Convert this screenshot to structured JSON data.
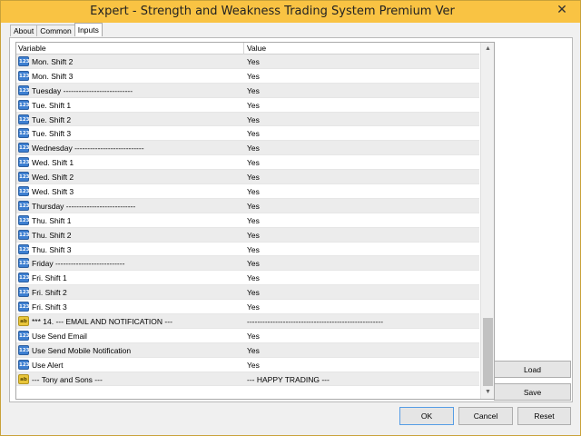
{
  "window": {
    "title": "Expert - Strength and Weakness Trading System Premium Ver",
    "close_glyph": "✕"
  },
  "tabs": [
    {
      "label": "About"
    },
    {
      "label": "Common"
    },
    {
      "label": "Inputs"
    }
  ],
  "grid": {
    "col_variable": "Variable",
    "col_value": "Value",
    "rows": [
      {
        "icon": "123",
        "name": "Mon. Shift 2",
        "value": "Yes"
      },
      {
        "icon": "123",
        "name": "Mon. Shift 3",
        "value": "Yes"
      },
      {
        "icon": "123",
        "name": "Tuesday ---------------------------",
        "value": "Yes"
      },
      {
        "icon": "123",
        "name": "Tue. Shift 1",
        "value": "Yes"
      },
      {
        "icon": "123",
        "name": "Tue. Shift 2",
        "value": "Yes"
      },
      {
        "icon": "123",
        "name": "Tue. Shift 3",
        "value": "Yes"
      },
      {
        "icon": "123",
        "name": "Wednesday ---------------------------",
        "value": "Yes"
      },
      {
        "icon": "123",
        "name": "Wed. Shift 1",
        "value": "Yes"
      },
      {
        "icon": "123",
        "name": "Wed. Shift 2",
        "value": "Yes"
      },
      {
        "icon": "123",
        "name": "Wed. Shift 3",
        "value": "Yes"
      },
      {
        "icon": "123",
        "name": "Thursday ---------------------------",
        "value": "Yes"
      },
      {
        "icon": "123",
        "name": "Thu. Shift 1",
        "value": "Yes"
      },
      {
        "icon": "123",
        "name": "Thu. Shift 2",
        "value": "Yes"
      },
      {
        "icon": "123",
        "name": "Thu. Shift 3",
        "value": "Yes"
      },
      {
        "icon": "123",
        "name": "Friday ---------------------------",
        "value": "Yes"
      },
      {
        "icon": "123",
        "name": "Fri. Shift 1",
        "value": "Yes"
      },
      {
        "icon": "123",
        "name": "Fri. Shift 2",
        "value": "Yes"
      },
      {
        "icon": "123",
        "name": "Fri. Shift 3",
        "value": "Yes"
      },
      {
        "icon": "ab",
        "name": "*** 14. --- EMAIL AND NOTIFICATION ---",
        "value": "-----------------------------------------------------"
      },
      {
        "icon": "123",
        "name": "Use Send Email",
        "value": "Yes"
      },
      {
        "icon": "123",
        "name": "Use Send Mobile Notification",
        "value": "Yes"
      },
      {
        "icon": "123",
        "name": "Use Alert",
        "value": "Yes"
      },
      {
        "icon": "ab",
        "name": "--- Tony and Sons ---",
        "value": "--- HAPPY TRADING ---"
      }
    ]
  },
  "scrollbar": {
    "up_glyph": "▲",
    "down_glyph": "▼"
  },
  "buttons": {
    "load": "Load",
    "save": "Save",
    "ok": "OK",
    "cancel": "Cancel",
    "reset": "Reset"
  }
}
